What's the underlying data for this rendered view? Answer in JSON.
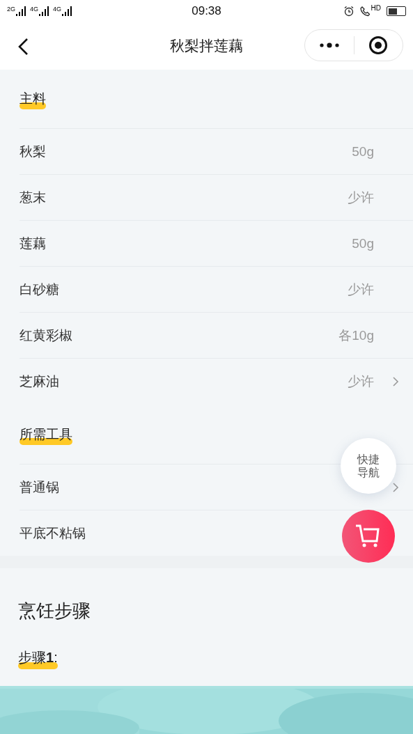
{
  "status_bar": {
    "networks": [
      "2G",
      "4G",
      "4G"
    ],
    "time": "09:38",
    "call_badge": "HD"
  },
  "header": {
    "title": "秋梨拌莲藕"
  },
  "sections": [
    {
      "title": "主料",
      "rows": [
        {
          "name": "秋梨",
          "amount": "50g",
          "has_arrow": false
        },
        {
          "name": "葱末",
          "amount": "少许",
          "has_arrow": false
        },
        {
          "name": "莲藕",
          "amount": "50g",
          "has_arrow": false
        },
        {
          "name": "白砂糖",
          "amount": "少许",
          "has_arrow": false
        },
        {
          "name": "红黄彩椒",
          "amount": "各10g",
          "has_arrow": false
        },
        {
          "name": "芝麻油",
          "amount": "少许",
          "has_arrow": true
        }
      ]
    },
    {
      "title": "所需工具",
      "rows": [
        {
          "name": "普通锅",
          "amount": "",
          "has_arrow": true
        },
        {
          "name": "平底不粘锅",
          "amount": "",
          "has_arrow": false
        }
      ]
    }
  ],
  "quick_nav": {
    "label": "快捷导航"
  },
  "steps": {
    "title": "烹饪步骤",
    "items": [
      {
        "label": "步骤**1**:"
      }
    ]
  }
}
